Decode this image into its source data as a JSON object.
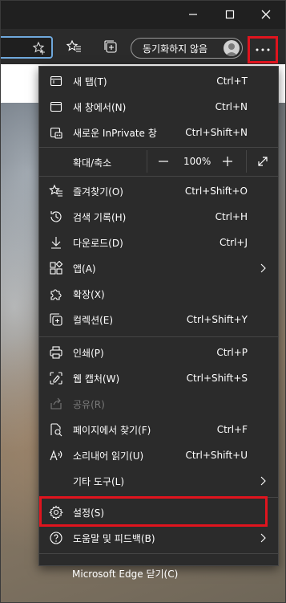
{
  "titlebar": {
    "minimize_icon": "minimize-icon",
    "maximize_icon": "maximize-icon",
    "close_icon": "close-icon"
  },
  "toolbar": {
    "sync_label": "동기화하지 않음",
    "more_icon": "ellipsis-icon"
  },
  "menu": {
    "items_top": [
      {
        "label": "새 탭(T)",
        "shortcut": "Ctrl+T",
        "icon": "new-tab-icon"
      },
      {
        "label": "새 창에서(N)",
        "shortcut": "Ctrl+N",
        "icon": "new-window-icon"
      },
      {
        "label": "새로운 InPrivate 창",
        "shortcut": "Ctrl+Shift+N",
        "icon": "inprivate-icon"
      }
    ],
    "zoom": {
      "label": "확대/축소",
      "value": "100%"
    },
    "items_mid": [
      {
        "label": "즐겨찾기(O)",
        "shortcut": "Ctrl+Shift+O",
        "icon": "favorites-icon"
      },
      {
        "label": "검색 기록(H)",
        "shortcut": "Ctrl+H",
        "icon": "history-icon"
      },
      {
        "label": "다운로드(D)",
        "shortcut": "Ctrl+J",
        "icon": "download-icon"
      },
      {
        "label": "앱(A)",
        "shortcut": "",
        "icon": "apps-icon",
        "submenu": true
      },
      {
        "label": "확장(X)",
        "shortcut": "",
        "icon": "extensions-icon"
      },
      {
        "label": "컬렉션(E)",
        "shortcut": "Ctrl+Shift+Y",
        "icon": "collections-icon"
      }
    ],
    "items_tools": [
      {
        "label": "인쇄(P)",
        "shortcut": "Ctrl+P",
        "icon": "print-icon"
      },
      {
        "label": "웹 캡처(W)",
        "shortcut": "Ctrl+Shift+S",
        "icon": "web-capture-icon"
      },
      {
        "label": "공유(R)",
        "shortcut": "",
        "icon": "share-icon",
        "disabled": true
      },
      {
        "label": "페이지에서 찾기(F)",
        "shortcut": "Ctrl+F",
        "icon": "find-icon"
      },
      {
        "label": "소리내어 읽기(U)",
        "shortcut": "Ctrl+Shift+U",
        "icon": "read-aloud-icon"
      },
      {
        "label": "기타 도구(L)",
        "shortcut": "",
        "icon": "",
        "submenu": true
      }
    ],
    "items_settings": [
      {
        "label": "설정(S)",
        "shortcut": "",
        "icon": "settings-icon"
      },
      {
        "label": "도움말 및 피드백(B)",
        "shortcut": "",
        "icon": "help-icon",
        "submenu": true
      }
    ],
    "close_label": "Microsoft Edge 닫기(C)"
  },
  "colors": {
    "highlight": "#e0141e",
    "menu_bg": "#2b2b2b",
    "toolbar_bg": "#2b2b2b",
    "address_border": "#6fa8dc"
  }
}
